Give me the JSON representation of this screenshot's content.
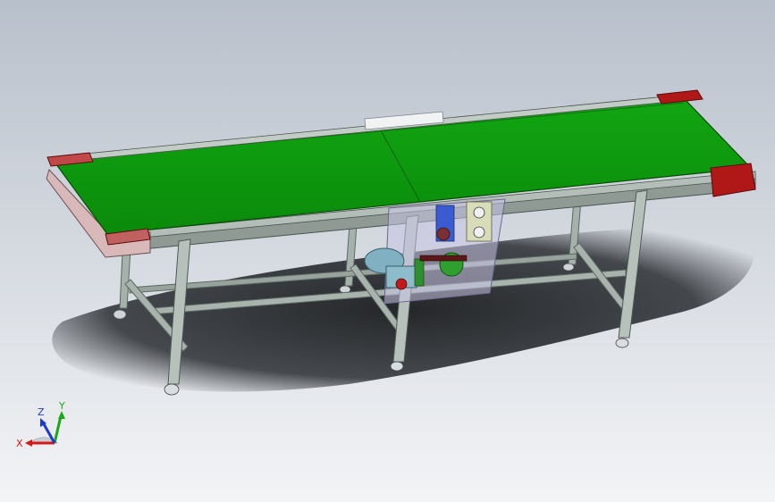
{
  "viewport": {
    "background_top": "#b8c0cb",
    "background_bottom": "#f3f4f6"
  },
  "model": {
    "belt_color": "#0f9e0f",
    "frame_color": "#9aa6a0",
    "end_cap_color": "#b01818",
    "motor_color": "#7fb1c2",
    "sprocket_color": "#2f9f2f"
  },
  "triad": {
    "x_label": "X",
    "y_label": "Y",
    "z_label": "Z",
    "x_color": "#d21a1a",
    "y_color": "#1aa81a",
    "z_color": "#1a3ad2"
  }
}
